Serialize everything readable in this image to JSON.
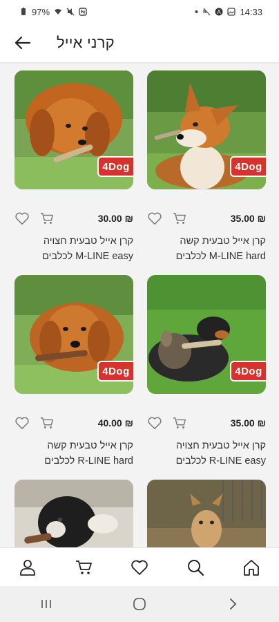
{
  "status": {
    "battery": "97%",
    "time": "14:33"
  },
  "header": {
    "title": "קרני אייל"
  },
  "currency": "₪",
  "products": [
    {
      "price": "35.00",
      "name": "קרן אייל טבעית קשה לכלבים M-LINE hard",
      "brand": "4Dog"
    },
    {
      "price": "30.00",
      "name": "קרן אייל טבעית חצויה לכלבים M-LINE easy",
      "brand": "4Dog"
    },
    {
      "price": "35.00",
      "name": "קרן אייל טבעית חצויה לכלבים R-LINE easy",
      "brand": "4Dog"
    },
    {
      "price": "40.00",
      "name": "קרן אייל טבעית קשה לכלבים R-LINE hard",
      "brand": "4Dog"
    },
    {
      "price": "",
      "name": "",
      "brand": ""
    },
    {
      "price": "",
      "name": "",
      "brand": ""
    }
  ],
  "nav": [
    "home-icon",
    "search-icon",
    "heart-icon",
    "cart-icon",
    "profile-icon"
  ],
  "colors": {
    "brand_badge": "#d8322f",
    "grass": "#6fa44a"
  }
}
